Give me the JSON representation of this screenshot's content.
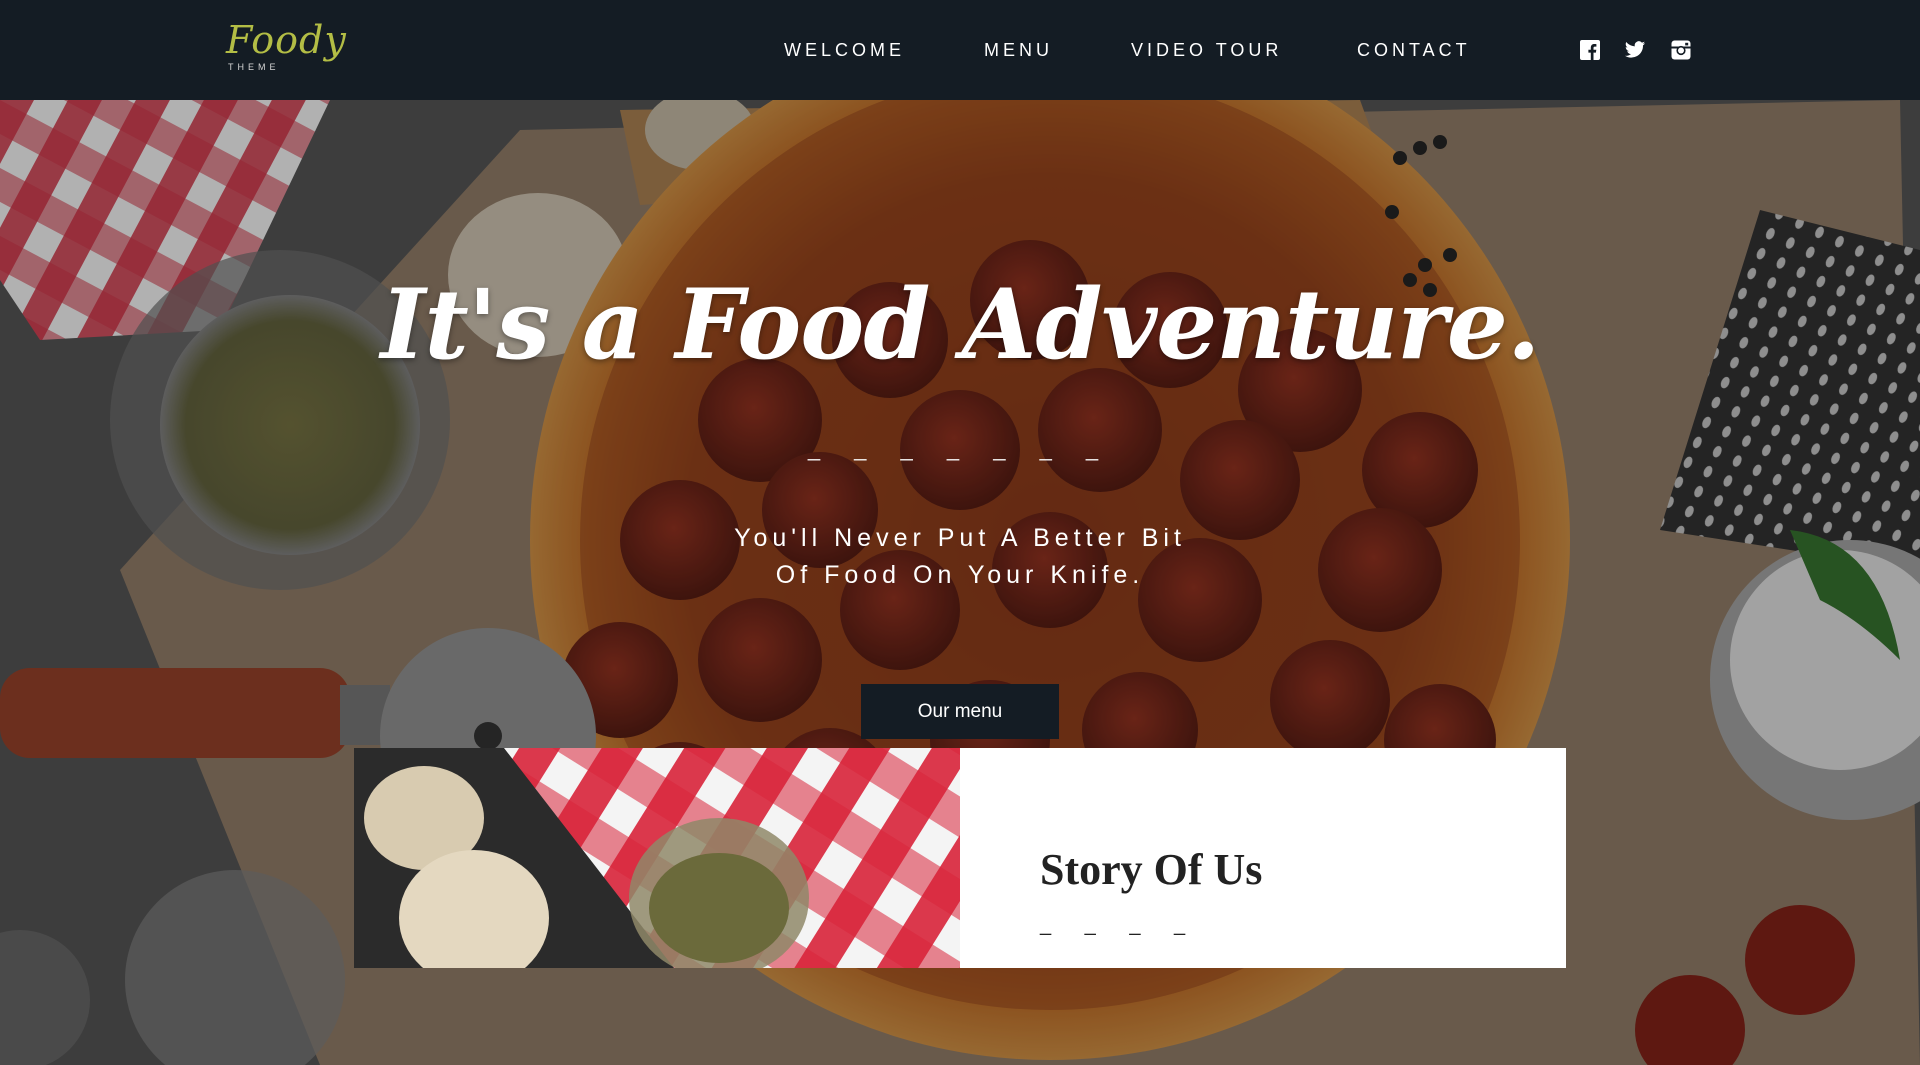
{
  "brand": {
    "name": "Foody",
    "tagline": "THEME",
    "color": "#b3bd45"
  },
  "nav": {
    "items": [
      {
        "label": "WELCOME"
      },
      {
        "label": "MENU"
      },
      {
        "label": "VIDEO TOUR"
      },
      {
        "label": "CONTACT"
      }
    ]
  },
  "social": [
    {
      "icon": "facebook-icon"
    },
    {
      "icon": "twitter-icon"
    },
    {
      "icon": "instagram-icon"
    }
  ],
  "hero": {
    "headline": "It's a Food Adventure.",
    "divider": "_ _ _ _ _ _ _",
    "tagline_line1": "You'll Never Put A Better Bit",
    "tagline_line2": "Of Food On Your Knife.",
    "cta_label": "Our menu"
  },
  "story": {
    "title": "Story Of Us",
    "divider": "_ _ _ _"
  },
  "colors": {
    "header_bg": "#141c24",
    "button_bg": "#141c24",
    "text": "#ffffff"
  }
}
